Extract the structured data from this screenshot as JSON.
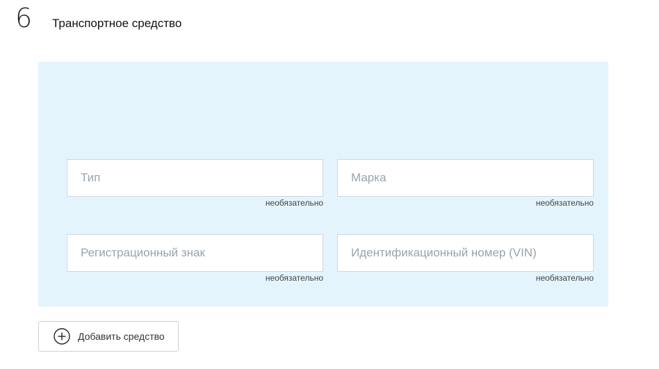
{
  "section": {
    "number": "6",
    "title": "Транспортное средство"
  },
  "fields": {
    "type": {
      "placeholder": "Тип",
      "value": "",
      "hint": "необязательно"
    },
    "brand": {
      "placeholder": "Марка",
      "value": "",
      "hint": "необязательно"
    },
    "registration": {
      "placeholder": "Регистрационный знак",
      "value": "",
      "hint": "необязательно"
    },
    "vin": {
      "placeholder": "Идентификационный номер (VIN)",
      "value": "",
      "hint": "необязательно"
    }
  },
  "actions": {
    "add_label": "Добавить средство",
    "add_icon": "plus-circle-icon"
  },
  "colors": {
    "panel_background": "#e4f4fd"
  }
}
